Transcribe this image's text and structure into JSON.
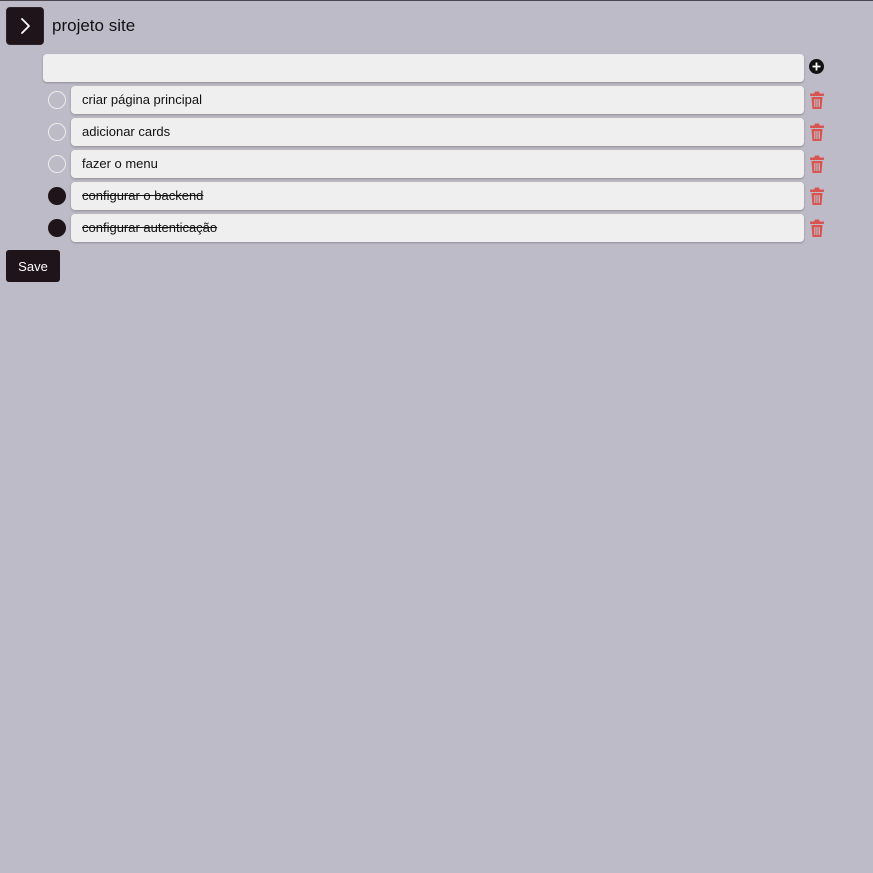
{
  "header": {
    "toggle_icon": "chevron-right-icon",
    "title": "projeto site"
  },
  "new_task": {
    "value": "",
    "placeholder": "",
    "add_icon": "plus-circle-icon"
  },
  "tasks": [
    {
      "label": "criar página principal",
      "done": false
    },
    {
      "label": "adicionar cards",
      "done": false
    },
    {
      "label": "fazer o menu",
      "done": false
    },
    {
      "label": "configurar o backend",
      "done": true
    },
    {
      "label": "configurar autenticação",
      "done": true
    }
  ],
  "delete_icon": "trash-icon",
  "save_label": "Save",
  "colors": {
    "background": "#bebbc8",
    "dark": "#1e1419",
    "input": "#efefef",
    "trash": "#d9534f"
  }
}
